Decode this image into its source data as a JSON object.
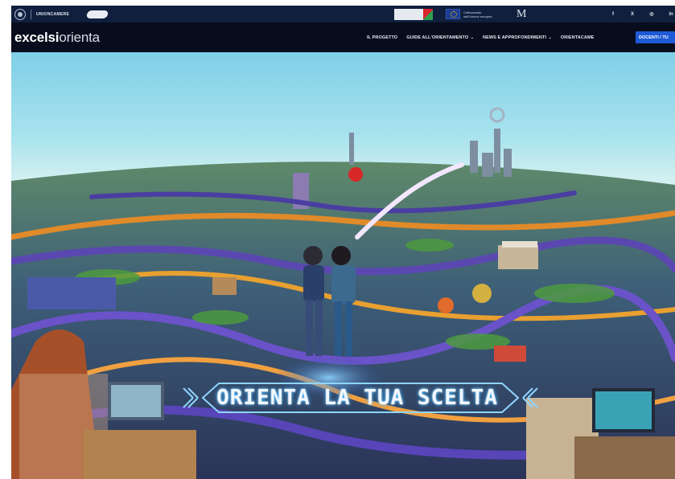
{
  "topbar": {
    "org_name": "UNIONCAMERE",
    "partners": [
      {
        "name": "Cofinanziato dall'Unione europea"
      },
      {
        "name": "M"
      }
    ],
    "social": [
      {
        "icon": "facebook-icon",
        "glyph": "f"
      },
      {
        "icon": "x-icon",
        "glyph": "X"
      },
      {
        "icon": "instagram-icon",
        "glyph": "◎"
      },
      {
        "icon": "linkedin-icon",
        "glyph": "in"
      },
      {
        "icon": "youtube-icon",
        "glyph": "▶"
      }
    ]
  },
  "header": {
    "logo_bold": "excelsi",
    "logo_light": "orienta",
    "nav": [
      {
        "label": "IL PROGETTO",
        "dropdown": false
      },
      {
        "label": "GUIDE ALL'ORIENTAMENTO",
        "dropdown": true
      },
      {
        "label": "NEWS E APPROFONDIMENTI",
        "dropdown": true
      },
      {
        "label": "ORIENTACAME",
        "dropdown": false
      }
    ],
    "cta_label": "DOCENTI / TU"
  },
  "hero": {
    "banner_text": "ORIENTA LA TUA SCELTA"
  },
  "colors": {
    "topbar": "#0f1f3d",
    "navbar": "#070d1c",
    "cta": "#1e5ad6"
  }
}
